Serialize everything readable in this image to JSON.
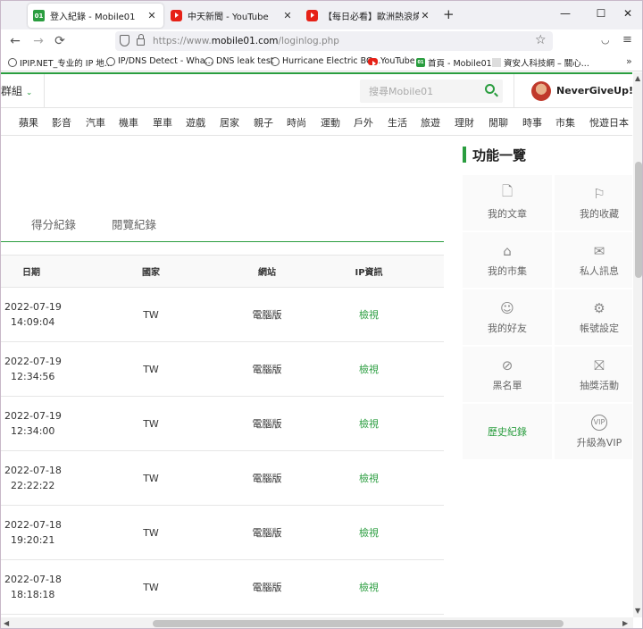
{
  "browser": {
    "tabs": [
      {
        "title": "登入紀錄 - Mobile01",
        "favicon": "mobile01-icon"
      },
      {
        "title": "中天新聞 - YouTube",
        "favicon": "youtube-icon"
      },
      {
        "title": "【每日必看】歐洲熱浪燒如煉獄",
        "favicon": "youtube-icon"
      }
    ],
    "new_tab": "+",
    "window_controls": {
      "minimize": "—",
      "maximize": "☐",
      "close": "✕"
    },
    "nav": {
      "back": "←",
      "forward": "→",
      "reload": "⟳"
    },
    "url": {
      "prefix": "https://www.",
      "domain": "mobile01.com",
      "path": "/loginlog.php"
    },
    "bookmarks": [
      "IPIP.NET_专业的 IP 地...",
      "IP/DNS Detect - Wha...",
      "DNS leak test",
      "Hurricane Electric BG...",
      "YouTube",
      "首頁 - Mobile01",
      "資安人科技網 – 關心..."
    ],
    "bookmarks_more": "»"
  },
  "header": {
    "group_label": "計群組",
    "search_placeholder": "搜尋Mobile01",
    "username": "NeverGiveUp!!"
  },
  "categories": [
    "蘋果",
    "影音",
    "汽車",
    "機車",
    "單車",
    "遊戲",
    "居家",
    "親子",
    "時尚",
    "運動",
    "戶外",
    "生活",
    "旅遊",
    "理財",
    "閒聊",
    "時事",
    "市集",
    "悅遊日本"
  ],
  "history_tabs": [
    "得分紀錄",
    "閱覽紀錄"
  ],
  "table": {
    "headers": [
      "日期",
      "國家",
      "網站",
      "IP資訊"
    ],
    "rows": [
      {
        "date": "2022-07-19",
        "time": "14:09:04",
        "country": "TW",
        "site": "電腦版",
        "ip": "檢視"
      },
      {
        "date": "2022-07-19",
        "time": "12:34:56",
        "country": "TW",
        "site": "電腦版",
        "ip": "檢視"
      },
      {
        "date": "2022-07-19",
        "time": "12:34:00",
        "country": "TW",
        "site": "電腦版",
        "ip": "檢視"
      },
      {
        "date": "2022-07-18",
        "time": "22:22:22",
        "country": "TW",
        "site": "電腦版",
        "ip": "檢視"
      },
      {
        "date": "2022-07-18",
        "time": "19:20:21",
        "country": "TW",
        "site": "電腦版",
        "ip": "檢視"
      },
      {
        "date": "2022-07-18",
        "time": "18:18:18",
        "country": "TW",
        "site": "電腦版",
        "ip": "檢視"
      }
    ]
  },
  "sidebar": {
    "title": "功能一覽",
    "items": [
      {
        "label": "我的文章",
        "icon": "document-icon"
      },
      {
        "label": "我的收藏",
        "icon": "bookmark-icon"
      },
      {
        "label": "我的市集",
        "icon": "store-icon"
      },
      {
        "label": "私人訊息",
        "icon": "envelope-icon"
      },
      {
        "label": "我的好友",
        "icon": "friends-icon"
      },
      {
        "label": "帳號設定",
        "icon": "gear-icon"
      },
      {
        "label": "黑名單",
        "icon": "block-icon"
      },
      {
        "label": "抽獎活動",
        "icon": "gift-icon"
      },
      {
        "label": "歷史紀錄",
        "icon": ""
      },
      {
        "label": "升級為VIP",
        "icon": "vip-icon"
      }
    ]
  },
  "colors": {
    "accent": "#2a9d3f"
  }
}
